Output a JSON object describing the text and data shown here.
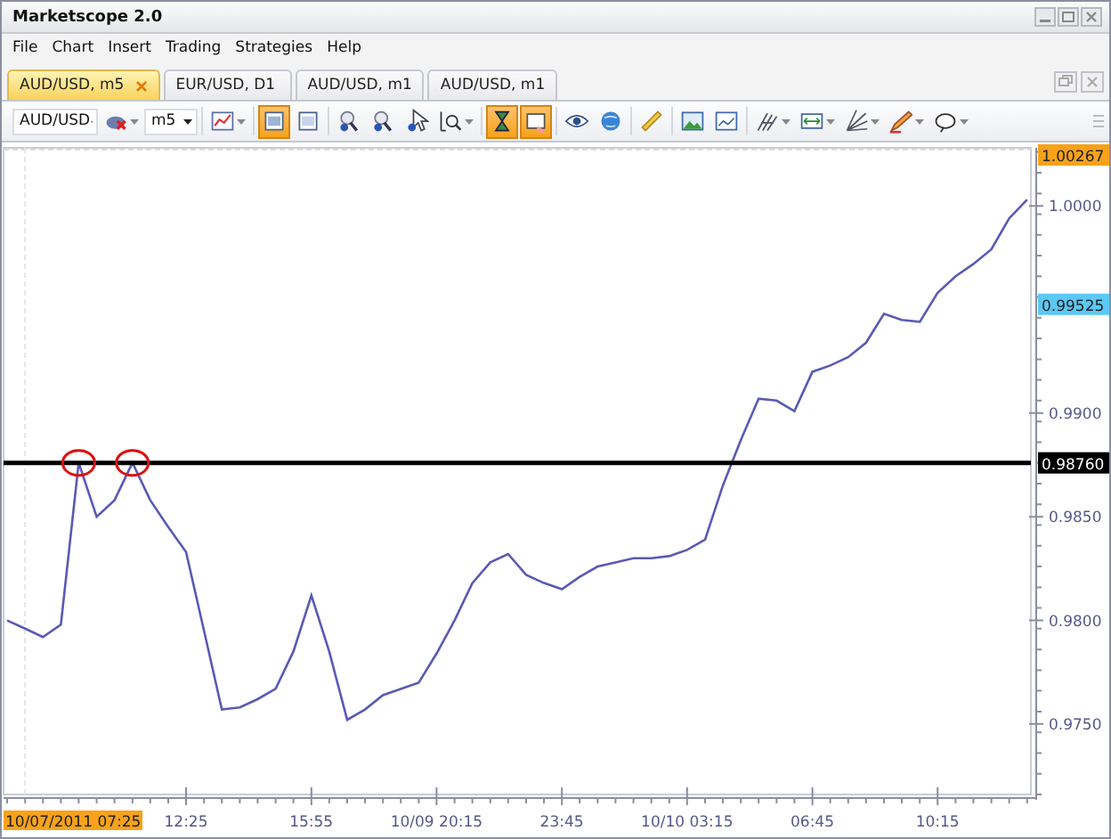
{
  "window": {
    "title": "Marketscope 2.0"
  },
  "menu": [
    "File",
    "Chart",
    "Insert",
    "Trading",
    "Strategies",
    "Help"
  ],
  "tabs": [
    {
      "label": "AUD/USD, m5",
      "selected": true
    },
    {
      "label": "EUR/USD, D1",
      "selected": false
    },
    {
      "label": "AUD/USD, m1",
      "selected": false
    },
    {
      "label": "AUD/USD, m1",
      "selected": false
    }
  ],
  "toolbar": {
    "symbol": "AUD/USD",
    "timeframe": "m5",
    "tools": [
      {
        "pressed": false,
        "menu": true
      },
      {
        "pressed": false,
        "menu": true
      },
      {
        "pressed": true,
        "menu": false
      },
      {
        "pressed": false,
        "menu": false
      },
      {
        "pressed": false,
        "menu": false
      },
      {
        "pressed": false,
        "menu": false
      },
      {
        "pressed": false,
        "menu": false
      },
      {
        "pressed": false,
        "menu": true
      },
      {
        "pressed": true,
        "menu": false
      },
      {
        "pressed": true,
        "menu": false
      },
      {
        "pressed": false,
        "menu": false
      },
      {
        "pressed": false,
        "menu": false
      },
      {
        "pressed": false,
        "menu": false
      },
      {
        "pressed": false,
        "menu": false
      },
      {
        "pressed": false,
        "menu": false
      },
      {
        "pressed": false,
        "menu": true
      },
      {
        "pressed": false,
        "menu": true
      },
      {
        "pressed": false,
        "menu": true
      },
      {
        "pressed": false,
        "menu": true
      },
      {
        "pressed": false,
        "menu": true
      }
    ]
  },
  "chart": {
    "chart_data": {
      "type": "line",
      "categories": [
        null,
        null,
        null,
        null,
        null,
        null,
        null,
        null,
        null,
        null,
        "12:25",
        null,
        null,
        null,
        null,
        null,
        null,
        "15:55",
        null,
        null,
        null,
        null,
        null,
        null,
        "10/09 20:15",
        null,
        null,
        null,
        null,
        null,
        null,
        "23:45",
        null,
        null,
        null,
        null,
        null,
        null,
        "10/10 03:15",
        null,
        null,
        null,
        null,
        null,
        null,
        "06:45",
        null,
        null,
        null,
        null,
        null,
        null,
        "10:15",
        null,
        null,
        null,
        null,
        null
      ],
      "series": [
        {
          "color": "#5a5ab4",
          "values": [
            0.98,
            0.9796,
            0.9792,
            0.9798,
            0.9876,
            0.985,
            0.9858,
            0.9876,
            0.9858,
            0.9845,
            0.9833,
            0.9795,
            0.9757,
            0.9758,
            0.9762,
            0.9767,
            0.9785,
            0.9812,
            0.9785,
            0.9752,
            0.9757,
            0.9764,
            0.9767,
            0.977,
            0.9784,
            0.98,
            0.9818,
            0.9828,
            0.9832,
            0.9822,
            0.9818,
            0.9815,
            0.9821,
            0.9826,
            0.9828,
            0.983,
            0.983,
            0.9831,
            0.9834,
            0.9839,
            0.9865,
            0.9887,
            0.9907,
            0.9906,
            0.9901,
            0.992,
            0.9923,
            0.9927,
            0.9934,
            0.9948,
            0.9945,
            0.9944,
            0.9958,
            0.9966,
            0.9972,
            0.9979,
            0.9994,
            1.0003
          ]
        }
      ],
      "ylim": [
        0.9716,
        1.0028
      ],
      "yticks": [
        {
          "value": 0.975,
          "label": "0.9750"
        },
        {
          "value": 0.98,
          "label": "0.9800"
        },
        {
          "value": 0.985,
          "label": "0.9850"
        },
        {
          "value": 0.99,
          "label": "0.9900"
        },
        {
          "value": 1.0,
          "label": "1.0000"
        }
      ],
      "ref_lines": [
        {
          "axis": "y",
          "value": 0.9876,
          "label": "0.98760"
        }
      ]
    },
    "price_tags": [
      {
        "text": "1.00267",
        "color": "#f7a21b"
      },
      {
        "text": "0.99525",
        "color": "#5bc8f5"
      }
    ],
    "time_tag": {
      "text": "10/07/2011 07:25",
      "color": "#f7a21b"
    }
  }
}
